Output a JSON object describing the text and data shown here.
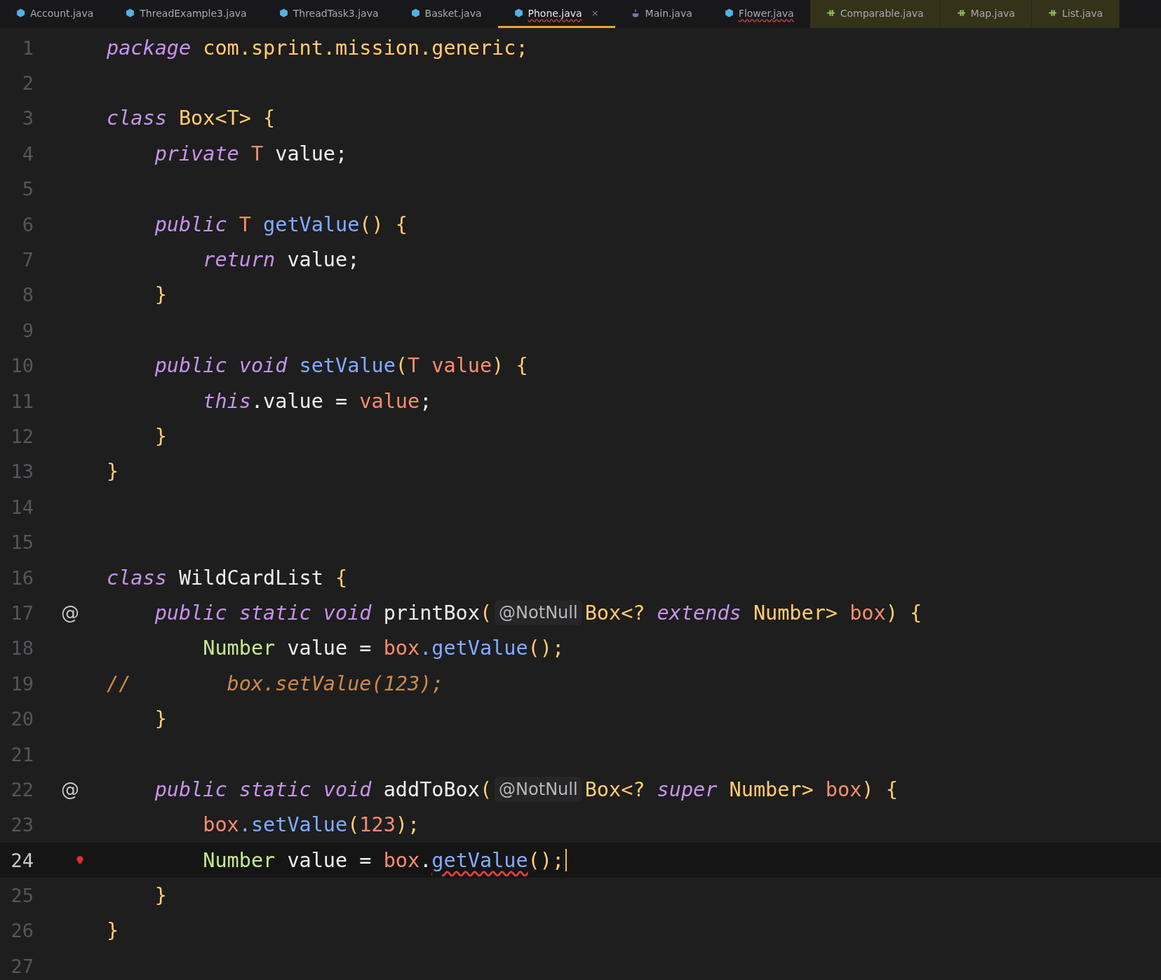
{
  "tabs": [
    {
      "label": "Account.java",
      "kind": "class",
      "selected": false,
      "error": false,
      "pinned": false
    },
    {
      "label": "ThreadExample3.java",
      "kind": "class",
      "selected": false,
      "error": false,
      "pinned": false
    },
    {
      "label": "ThreadTask3.java",
      "kind": "class",
      "selected": false,
      "error": false,
      "pinned": false
    },
    {
      "label": "Basket.java",
      "kind": "class",
      "selected": false,
      "error": false,
      "pinned": false
    },
    {
      "label": "Phone.java",
      "kind": "class",
      "selected": true,
      "error": true,
      "pinned": false,
      "close": "×"
    },
    {
      "label": "Main.java",
      "kind": "main",
      "selected": false,
      "error": false,
      "pinned": false
    },
    {
      "label": "Flower.java",
      "kind": "class",
      "selected": false,
      "error": true,
      "pinned": false
    },
    {
      "label": "Comparable.java",
      "kind": "interface",
      "selected": false,
      "error": false,
      "pinned": true
    },
    {
      "label": "Map.java",
      "kind": "interface",
      "selected": false,
      "error": false,
      "pinned": true
    },
    {
      "label": "List.java",
      "kind": "interface",
      "selected": false,
      "error": false,
      "pinned": true
    }
  ],
  "lines": [
    {
      "number": "1",
      "current": false,
      "tokens": [
        {
          "t": "package",
          "kind": "kw"
        },
        {
          "t": " com.sprint.mission.generic;",
          "kind": "pkg"
        }
      ]
    },
    {
      "number": "2",
      "current": false
    },
    {
      "number": "3",
      "current": false,
      "tokens": [
        {
          "t": "class",
          "kind": "kw"
        },
        {
          "t": " Box<T> ",
          "kind": "cls"
        },
        {
          "t": "{",
          "kind": "brace"
        }
      ]
    },
    {
      "number": "4",
      "current": false,
      "tokens": [
        {
          "t": "    private",
          "kind": "kw"
        },
        {
          "t": " T",
          "kind": "tparam"
        },
        {
          "t": " value;",
          "kind": "plain"
        }
      ]
    },
    {
      "number": "5",
      "current": false
    },
    {
      "number": "6",
      "current": false,
      "tokens": [
        {
          "t": "    public",
          "kind": "kw"
        },
        {
          "t": " T",
          "kind": "tparam"
        },
        {
          "t": " getValue",
          "kind": "fn"
        },
        {
          "t": "() {",
          "kind": "brace"
        }
      ]
    },
    {
      "number": "7",
      "current": false,
      "tokens": [
        {
          "t": "        return",
          "kind": "kw"
        },
        {
          "t": " value;",
          "kind": "plain"
        }
      ]
    },
    {
      "number": "8",
      "current": false,
      "tokens": [
        {
          "t": "    }",
          "kind": "brace"
        }
      ]
    },
    {
      "number": "9",
      "current": false
    },
    {
      "number": "10",
      "current": false,
      "tokens": [
        {
          "t": "    public void",
          "kind": "kw"
        },
        {
          "t": " setValue",
          "kind": "fn"
        },
        {
          "t": "(",
          "kind": "brace"
        },
        {
          "t": "T value",
          "kind": "tparam"
        },
        {
          "t": ") {",
          "kind": "brace"
        }
      ]
    },
    {
      "number": "11",
      "current": false,
      "tokens": [
        {
          "t": "        this",
          "kind": "kw"
        },
        {
          "t": ".value = ",
          "kind": "plain"
        },
        {
          "t": "value",
          "kind": "param"
        },
        {
          "t": ";",
          "kind": "plain"
        }
      ]
    },
    {
      "number": "12",
      "current": false,
      "tokens": [
        {
          "t": "    }",
          "kind": "brace"
        }
      ]
    },
    {
      "number": "13",
      "current": false,
      "tokens": [
        {
          "t": "}",
          "kind": "brace"
        }
      ]
    },
    {
      "number": "14",
      "current": false
    },
    {
      "number": "15",
      "current": false
    },
    {
      "number": "16",
      "current": false,
      "tokens": [
        {
          "t": "class",
          "kind": "kw"
        },
        {
          "t": " WildCardList ",
          "kind": "plain"
        },
        {
          "t": "{",
          "kind": "brace"
        }
      ]
    },
    {
      "number": "17",
      "current": false,
      "mark": "@",
      "tokens": [
        {
          "t": "    public static void",
          "kind": "kw"
        },
        {
          "t": " printBox",
          "kind": "plain"
        },
        {
          "t": "(",
          "kind": "brace"
        },
        {
          "t": "@NotNull",
          "kind": "hint"
        },
        {
          "t": "Box<? ",
          "kind": "cls"
        },
        {
          "t": "extends",
          "kind": "kw"
        },
        {
          "t": " Number> ",
          "kind": "cls"
        },
        {
          "t": "box",
          "kind": "param"
        },
        {
          "t": ") {",
          "kind": "brace"
        }
      ]
    },
    {
      "number": "18",
      "current": false,
      "tokens": [
        {
          "t": "        Number",
          "kind": "type"
        },
        {
          "t": " value = ",
          "kind": "plain"
        },
        {
          "t": "box",
          "kind": "param"
        },
        {
          "t": ".getValue",
          "kind": "fn"
        },
        {
          "t": "();",
          "kind": "brace"
        }
      ]
    },
    {
      "number": "19",
      "current": false,
      "tokens": [
        {
          "t": "//        box.setValue(123);",
          "kind": "comment"
        }
      ]
    },
    {
      "number": "20",
      "current": false,
      "tokens": [
        {
          "t": "    }",
          "kind": "brace"
        }
      ]
    },
    {
      "number": "21",
      "current": false
    },
    {
      "number": "22",
      "current": false,
      "mark": "@",
      "tokens": [
        {
          "t": "    public static void",
          "kind": "kw"
        },
        {
          "t": " addToBox",
          "kind": "plain"
        },
        {
          "t": "(",
          "kind": "brace"
        },
        {
          "t": "@NotNull",
          "kind": "hint"
        },
        {
          "t": "Box<? ",
          "kind": "cls"
        },
        {
          "t": "super",
          "kind": "kw"
        },
        {
          "t": " Number> ",
          "kind": "cls"
        },
        {
          "t": "box",
          "kind": "param"
        },
        {
          "t": ") {",
          "kind": "brace"
        }
      ]
    },
    {
      "number": "23",
      "current": false,
      "tokens": [
        {
          "t": "        box",
          "kind": "param"
        },
        {
          "t": ".setValue",
          "kind": "fn"
        },
        {
          "t": "(",
          "kind": "brace"
        },
        {
          "t": "123",
          "kind": "param"
        },
        {
          "t": ");",
          "kind": "brace"
        }
      ]
    },
    {
      "number": "24",
      "current": true,
      "bulb": true,
      "tokens": [
        {
          "t": "        Number",
          "kind": "type"
        },
        {
          "t": " value = ",
          "kind": "plain"
        },
        {
          "t": "box",
          "kind": "param"
        },
        {
          "t": ".",
          "kind": "plain"
        },
        {
          "t": "getValue",
          "kind": "error"
        },
        {
          "t": "();",
          "kind": "brace"
        }
      ]
    },
    {
      "number": "25",
      "current": false,
      "tokens": [
        {
          "t": "    }",
          "kind": "brace"
        }
      ]
    },
    {
      "number": "26",
      "current": false,
      "tokens": [
        {
          "t": "}",
          "kind": "brace"
        }
      ]
    },
    {
      "number": "27",
      "current": false
    }
  ]
}
